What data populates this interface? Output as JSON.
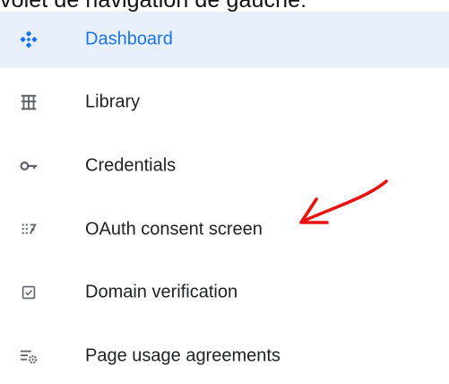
{
  "caption": "volet de navigation de gauche:",
  "nav": {
    "items": [
      {
        "label": "Dashboard",
        "icon": "dashboard-diamond-icon",
        "active": true
      },
      {
        "label": "Library",
        "icon": "library-icon",
        "active": false
      },
      {
        "label": "Credentials",
        "icon": "key-icon",
        "active": false
      },
      {
        "label": "OAuth consent screen",
        "icon": "oauth-consent-icon",
        "active": false
      },
      {
        "label": "Domain verification",
        "icon": "checkbox-icon",
        "active": false
      },
      {
        "label": "Page usage agreements",
        "icon": "settings-list-icon",
        "active": false
      }
    ]
  },
  "colors": {
    "active_background": "#e8f0fe",
    "active_text": "#1a73e8",
    "text": "#202124",
    "icon_active": "#1a73e8",
    "icon": "#5f6368",
    "annotation_arrow": "#e8130f"
  }
}
